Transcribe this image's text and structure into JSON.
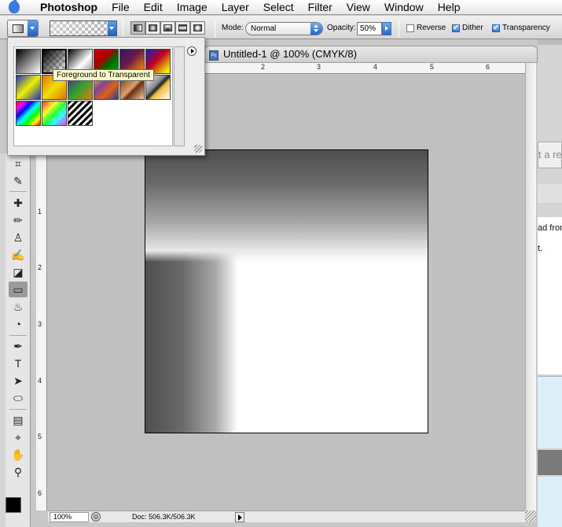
{
  "menubar": {
    "app_name": "Photoshop",
    "items": [
      "File",
      "Edit",
      "Image",
      "Layer",
      "Select",
      "Filter",
      "View",
      "Window",
      "Help"
    ]
  },
  "options": {
    "mode_label": "Mode:",
    "mode_value": "Normal",
    "opacity_label": "Opacity:",
    "opacity_value": "50%",
    "reverse_label": "Reverse",
    "reverse_checked": false,
    "dither_label": "Dither",
    "dither_checked": true,
    "transparency_label": "Transparency",
    "transparency_checked": true
  },
  "gradient_picker": {
    "tooltip": "Foreground to Transparent",
    "swatches": [
      "foreground-to-background",
      "foreground-to-transparent",
      "black-white",
      "red-green",
      "violet-orange",
      "blue-red-yellow",
      "blue-yellow-blue",
      "orange-yellow-orange",
      "violet-green-orange",
      "yellow-violet-orange-blue",
      "copper",
      "chrome",
      "spectrum",
      "transparent-rainbow",
      "transparent-stripes"
    ]
  },
  "document": {
    "title": "Untitled-1 @ 100% (CMYK/8)",
    "ruler_h": [
      "2",
      "3",
      "4",
      "5",
      "6"
    ],
    "ruler_v": [
      "1",
      "2",
      "3",
      "4",
      "5",
      "6"
    ],
    "zoom": "100%",
    "doc_size": "Doc: 506.3K/506.3K"
  },
  "right_panel": {
    "text1": "t a re",
    "text2": "ad fron",
    "text3": "t."
  },
  "colors": {
    "accent": "#2466cf",
    "foreground": "#000000",
    "background": "#ffffff"
  }
}
